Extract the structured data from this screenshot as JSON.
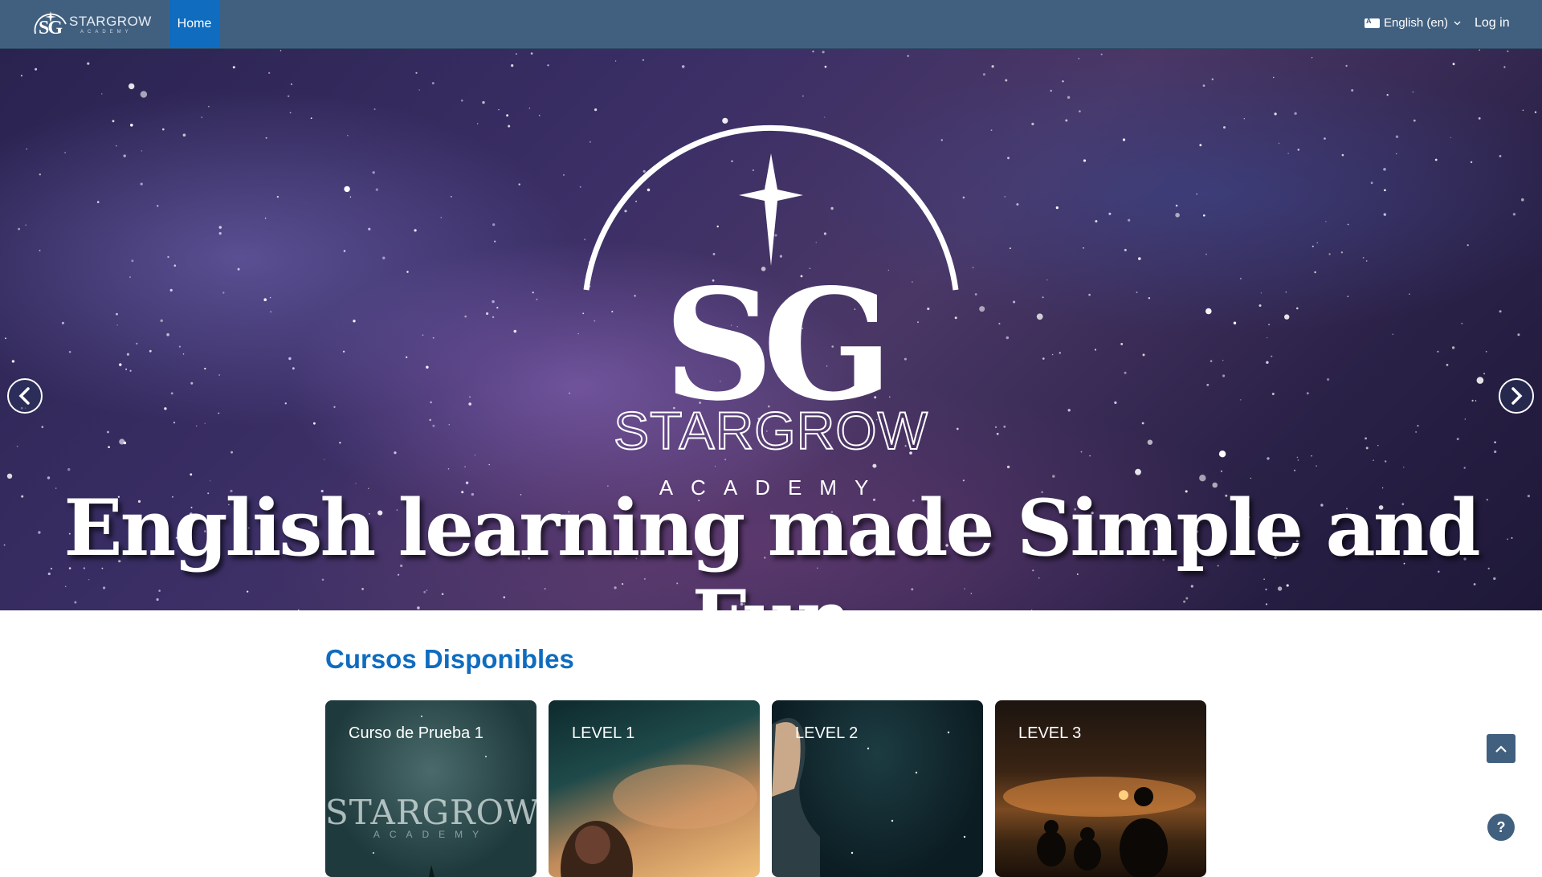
{
  "header": {
    "brand_name": "STARGROW",
    "brand_sub": "ACADEMY",
    "brand_mark": "SG",
    "nav": {
      "home_label": "Home"
    },
    "language_label": "English (en)",
    "login_label": "Log in"
  },
  "hero": {
    "logo_mark": "SG",
    "logo_name": "STARGROW",
    "logo_sub": "ACADEMY",
    "tagline": "English learning made Simple and Fun",
    "prev_icon": "chevron-left-icon",
    "next_icon": "chevron-right-icon"
  },
  "courses": {
    "title": "Cursos Disponibles",
    "items": [
      {
        "name": "Curso de Prueba 1",
        "watermark": "STARGROW",
        "watermark_sub": "ACADEMY"
      },
      {
        "name": "LEVEL 1"
      },
      {
        "name": "LEVEL 2"
      },
      {
        "name": "LEVEL 3"
      }
    ]
  },
  "floating": {
    "back_to_top_icon": "chevron-up-icon",
    "help_label": "?"
  },
  "colors": {
    "navbar": "#41607f",
    "accent": "#0f6cbf",
    "section_title": "#0f6cbf"
  }
}
